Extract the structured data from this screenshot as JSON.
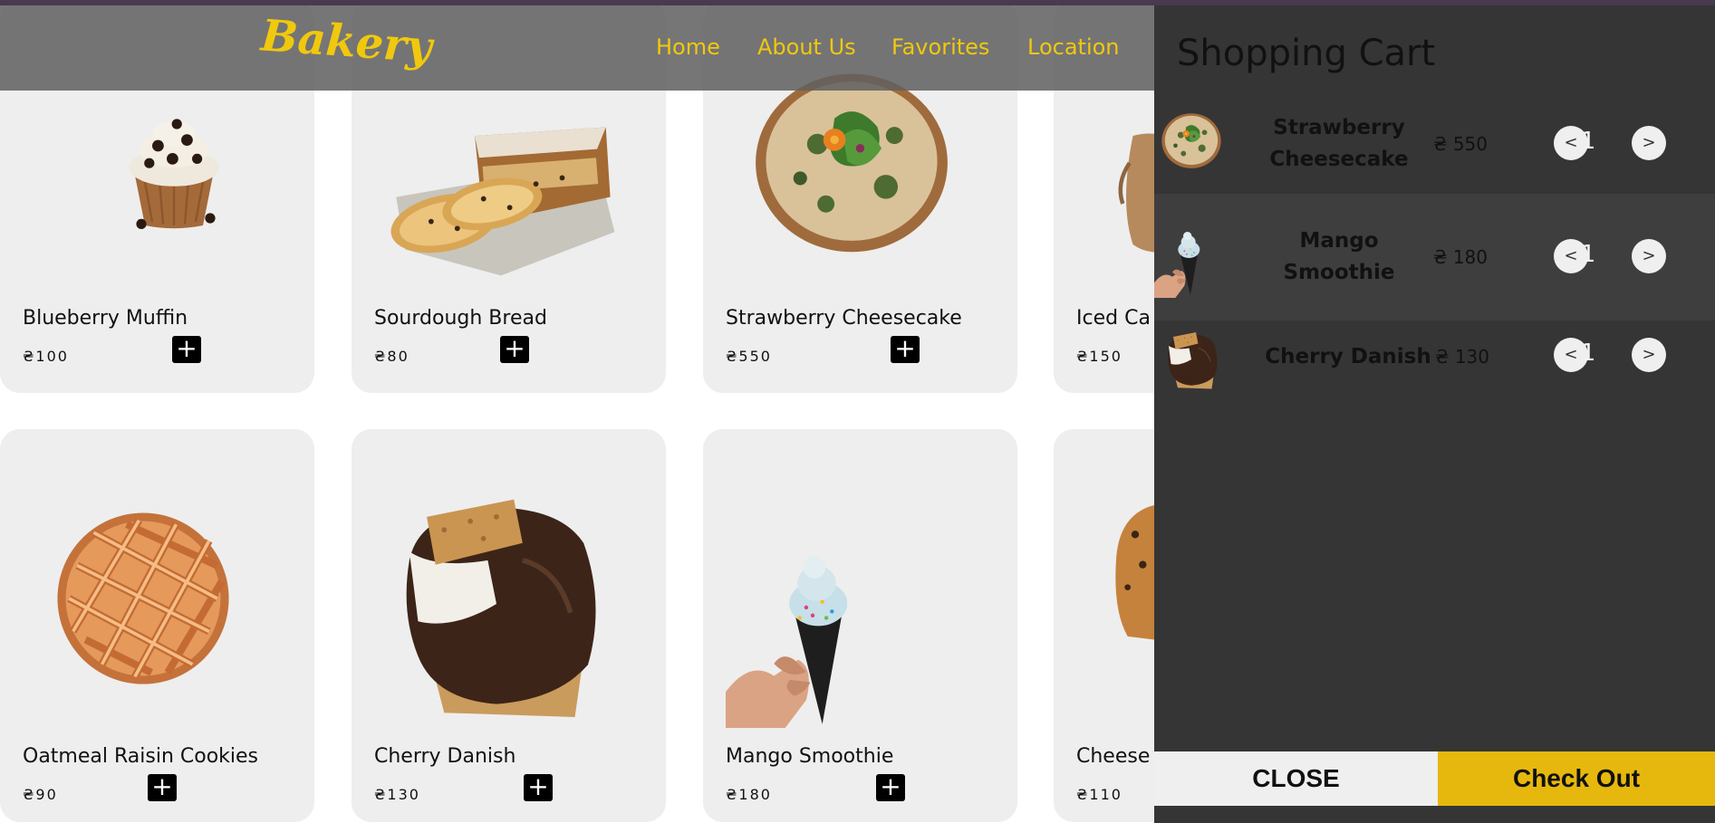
{
  "brand": {
    "logo": "Bakery"
  },
  "nav": {
    "home": "Home",
    "about": "About Us",
    "favorites": "Favorites",
    "location": "Location"
  },
  "products": [
    {
      "name": "Blueberry Muffin",
      "price": "₴100"
    },
    {
      "name": "Sourdough Bread",
      "price": "₴80"
    },
    {
      "name": "Strawberry Cheesecake",
      "price": "₴550"
    },
    {
      "name": "Iced Ca",
      "price": "₴150"
    },
    {
      "name": "Oatmeal Raisin Cookies",
      "price": "₴90"
    },
    {
      "name": "Cherry Danish",
      "price": "₴130"
    },
    {
      "name": "Mango Smoothie",
      "price": "₴180"
    },
    {
      "name": "Cheese",
      "price": "₴110"
    }
  ],
  "add_button": "+",
  "cart": {
    "title": "Shopping Cart",
    "items": [
      {
        "name": "Strawberry Cheesecake",
        "price": "₴ 550",
        "qty": "1"
      },
      {
        "name": "Mango Smoothie",
        "price": "₴ 180",
        "qty": "1"
      },
      {
        "name": "Cherry Danish",
        "price": "₴ 130",
        "qty": "1"
      }
    ],
    "decrement": "<",
    "increment": ">",
    "close_label": "CLOSE",
    "checkout_label": "Check Out"
  },
  "colors": {
    "accent_yellow": "#f0c90f",
    "checkout_yellow": "#e6b80d",
    "cart_bg": "#353535",
    "card_bg": "#eeeeee",
    "header_bg": "#5f5f5f"
  }
}
